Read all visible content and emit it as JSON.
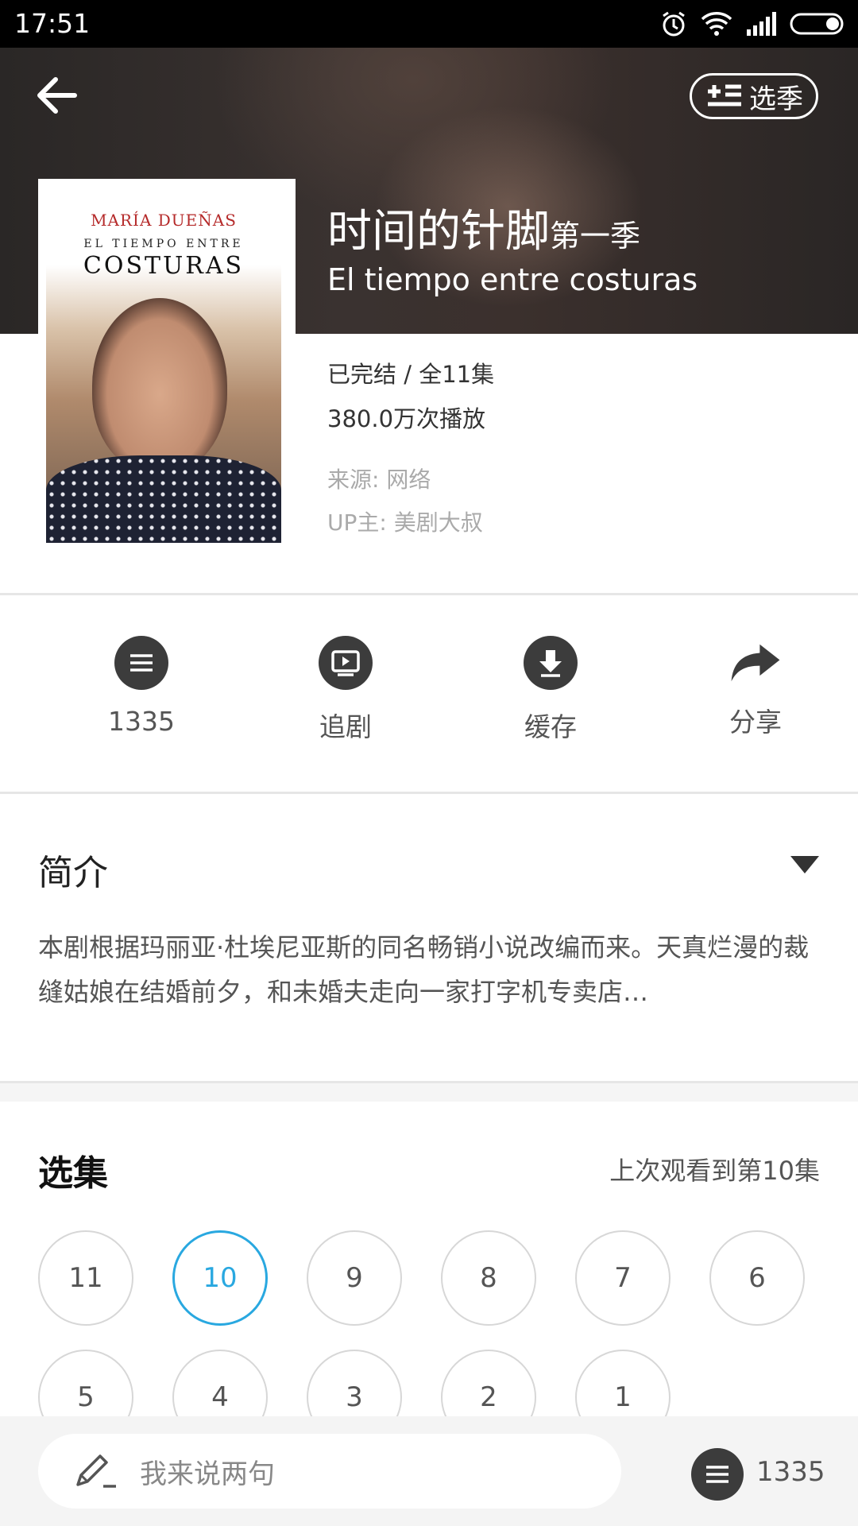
{
  "status_bar": {
    "time": "17:51",
    "icons": [
      "alarm-icon",
      "wifi-icon",
      "signal-icon",
      "battery-icon"
    ]
  },
  "header": {
    "back_icon": "back-arrow-icon",
    "season_button": {
      "icon": "list-add-icon",
      "label": "选季"
    }
  },
  "show": {
    "title_zh": "时间的针脚",
    "season_label": "第一季",
    "title_en": "El tiempo entre costuras",
    "poster": {
      "author": "MARÍA DUEÑAS",
      "subtitle": "EL TIEMPO ENTRE",
      "main": "COSTURAS"
    },
    "status": "已完结 / 全11集",
    "plays": "380.0万次播放",
    "source": "来源: 网络",
    "uploader": "UP主: 美剧大叔"
  },
  "actions": [
    {
      "icon": "comment-icon",
      "label": "1335"
    },
    {
      "icon": "follow-tv-icon",
      "label": "追剧"
    },
    {
      "icon": "download-icon",
      "label": "缓存"
    },
    {
      "icon": "share-icon",
      "label": "分享"
    }
  ],
  "intro": {
    "title": "简介",
    "text": "本剧根据玛丽亚·杜埃尼亚斯的同名畅销小说改编而来。天真烂漫的裁缝姑娘在结婚前夕，和未婚夫走向一家打字机专卖店…"
  },
  "episodes": {
    "title": "选集",
    "last_watched": "上次观看到第10集",
    "items": [
      "11",
      "10",
      "9",
      "8",
      "7",
      "6",
      "5",
      "4",
      "3",
      "2",
      "1"
    ],
    "active": "10"
  },
  "bottom_bar": {
    "placeholder": "我来说两句",
    "comment_count": "1335"
  },
  "colors": {
    "accent": "#29a8e0",
    "icon_dark": "#3c3c3c"
  }
}
